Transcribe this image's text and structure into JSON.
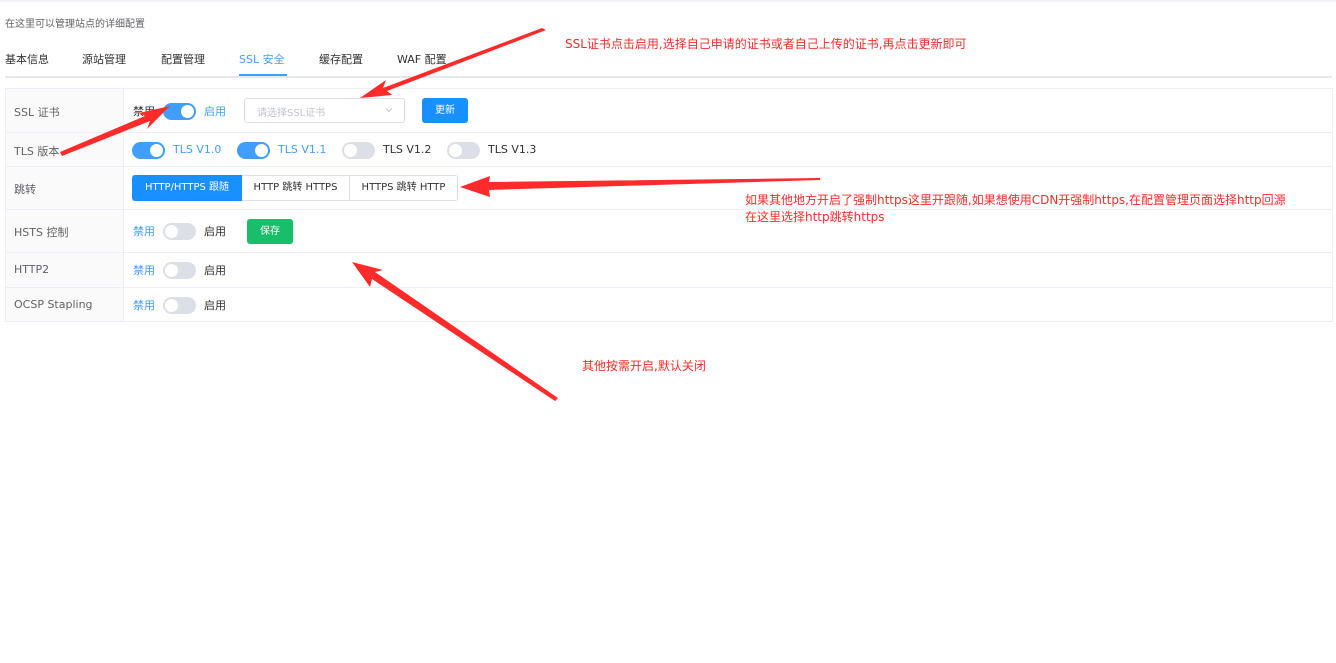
{
  "page": {
    "description": "在这里可以管理站点的详细配置"
  },
  "tabs": [
    {
      "label": "基本信息"
    },
    {
      "label": "源站管理"
    },
    {
      "label": "配置管理"
    },
    {
      "label": "SSL 安全"
    },
    {
      "label": "缓存配置"
    },
    {
      "label": "WAF 配置"
    }
  ],
  "active_tab": "SSL 安全",
  "rows": {
    "ssl_cert": {
      "label": "SSL 证书",
      "off_label": "禁用",
      "on_label": "启用",
      "enabled": true,
      "select_placeholder": "请选择SSL证书",
      "update_button": "更新"
    },
    "tls": {
      "label": "TLS 版本",
      "versions": [
        {
          "label": "TLS V1.0",
          "enabled": true
        },
        {
          "label": "TLS V1.1",
          "enabled": true
        },
        {
          "label": "TLS V1.2",
          "enabled": false
        },
        {
          "label": "TLS V1.3",
          "enabled": false
        }
      ]
    },
    "redirect": {
      "label": "跳转",
      "options": [
        "HTTP/HTTPS 跟随",
        "HTTP 跳转 HTTPS",
        "HTTPS 跳转 HTTP"
      ],
      "selected": "HTTP/HTTPS 跟随"
    },
    "hsts": {
      "label": "HSTS 控制",
      "off_label": "禁用",
      "on_label": "启用",
      "enabled": false,
      "save_button": "保存"
    },
    "http2": {
      "label": "HTTP2",
      "off_label": "禁用",
      "on_label": "启用",
      "enabled": false
    },
    "ocsp": {
      "label": "OCSP Stapling",
      "off_label": "禁用",
      "on_label": "启用",
      "enabled": false
    }
  },
  "annotations": {
    "ssl_note": "SSL证书点击启用,选择自己申请的证书或者自己上传的证书,再点击更新即可",
    "redirect_note_line1": "如果其他地方开启了强制https这里开跟随,如果想使用CDN开强制https,在配置管理页面选择http回源",
    "redirect_note_line2": "在这里选择http跳转https",
    "other_note": "其他按需开启,默认关闭"
  },
  "colors": {
    "primary": "#409eff",
    "button_blue": "#1890ff",
    "save_green": "#19be6b",
    "annotation_red": "#ff2a2a"
  }
}
